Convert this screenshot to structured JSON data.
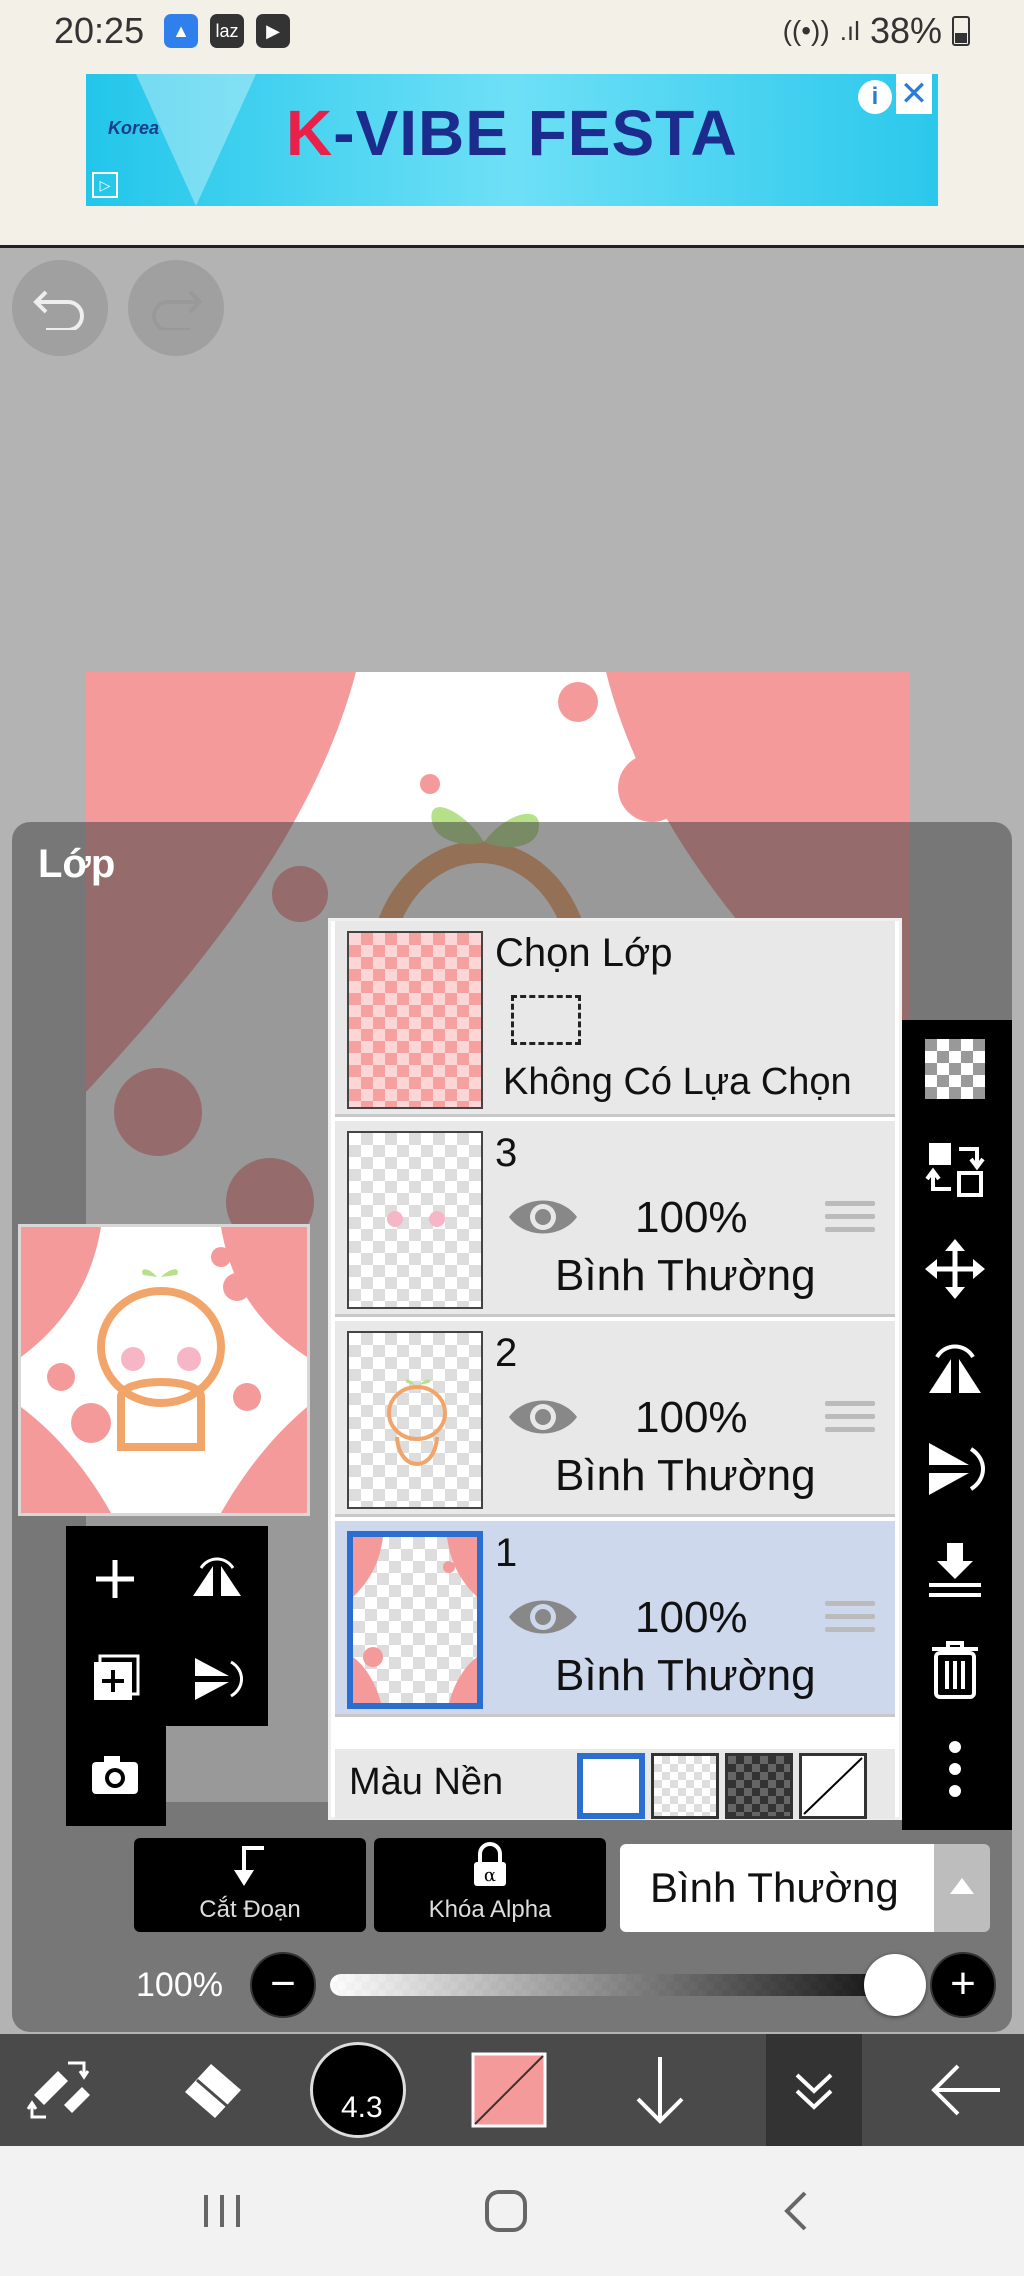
{
  "status_bar": {
    "time": "20:25",
    "battery": "38%",
    "notif_icons": [
      "rocket-icon",
      "laz-icon",
      "youtube-icon"
    ],
    "laz_label": "laz"
  },
  "ad": {
    "title": "K-VIBE FESTA",
    "logo": "Korea"
  },
  "layers_panel": {
    "title": "Lớp",
    "selection_layer": {
      "name": "Chọn Lớp",
      "status": "Không Có Lựa Chọn"
    },
    "layers": [
      {
        "name": "3",
        "opacity": "100%",
        "blend": "Bình Thường",
        "selected": false
      },
      {
        "name": "2",
        "opacity": "100%",
        "blend": "Bình Thường",
        "selected": false
      },
      {
        "name": "1",
        "opacity": "100%",
        "blend": "Bình Thường",
        "selected": true
      }
    ],
    "background": {
      "label": "Màu Nền",
      "options": [
        "white",
        "transparent",
        "dark-checker",
        "none"
      ],
      "selected": "white"
    },
    "clip_button": "Cắt Đoạn",
    "alpha_lock_button": "Khóa Alpha",
    "blend_mode": "Bình Thường",
    "opacity_label": "100%",
    "opacity_value": 1.0
  },
  "bottom_toolbar": {
    "brush_size": "4.3",
    "current_color": "#f59a9a"
  },
  "colors": {
    "accent_blue": "#2a6fd0",
    "canvas_pink": "#f59a9a",
    "toolbar_bg": "#4a4a4a"
  }
}
